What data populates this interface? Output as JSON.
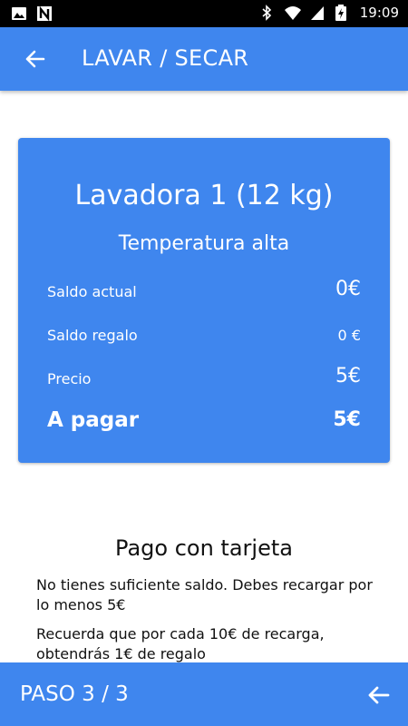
{
  "status_bar": {
    "time": "19:09",
    "icons": [
      "image-icon",
      "n-icon",
      "bluetooth-icon",
      "wifi-icon",
      "signal-icon",
      "battery-charging-icon"
    ]
  },
  "app_bar": {
    "title": "LAVAR / SECAR",
    "back_icon": "arrow-left-icon"
  },
  "summary": {
    "machine": "Lavadora 1 (12 kg)",
    "program": "Temperatura alta",
    "rows": [
      {
        "label": "Saldo actual",
        "value": "0€"
      },
      {
        "label": "Saldo regalo",
        "value": "0 €"
      },
      {
        "label": "Precio",
        "value": "5€"
      }
    ],
    "total": {
      "label": "A pagar",
      "value": "5€"
    }
  },
  "payment": {
    "title": "Pago con tarjeta",
    "notice": "No tienes suficiente saldo. Debes recargar por lo menos 5€",
    "bonus": "Recuerda que por cada 10€ de recarga, obtendrás 1€ de regalo"
  },
  "bottom_bar": {
    "step": "PASO 3 / 3",
    "next_icon": "arrow-left-icon"
  },
  "colors": {
    "primary": "#3f86ee",
    "text_on_primary": "#ffffff",
    "status_bar": "#000000"
  }
}
